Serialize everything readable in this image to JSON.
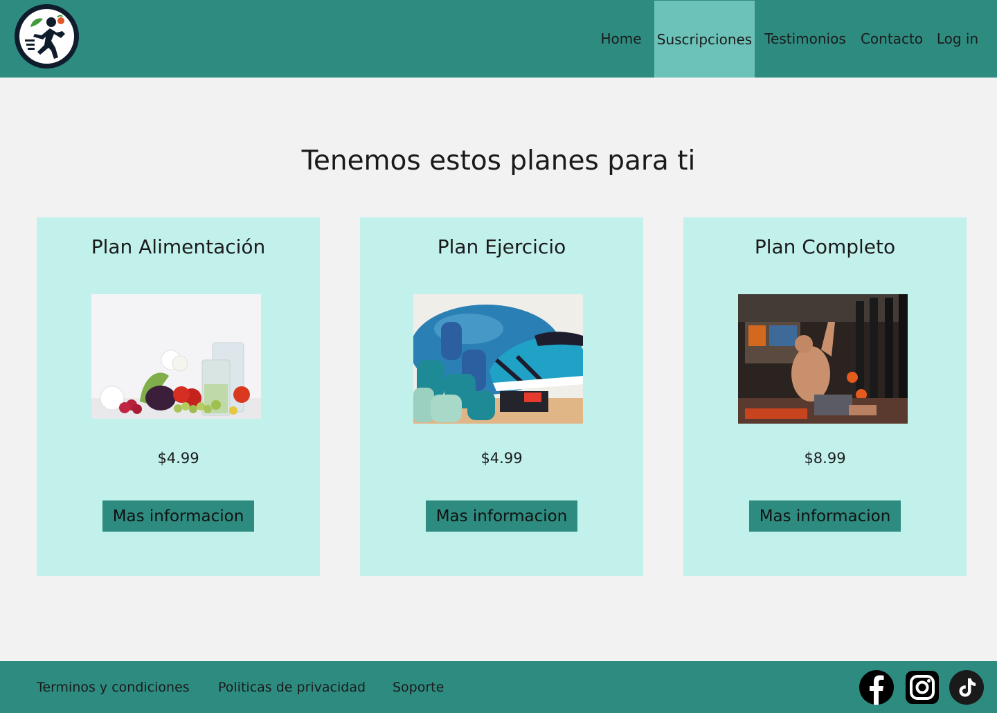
{
  "nav": {
    "home": "Home",
    "suscripciones": "Suscripciones",
    "testimonios": "Testimonios",
    "contacto": "Contacto",
    "login": "Log in",
    "active": "Suscripciones"
  },
  "main": {
    "heading": "Tenemos estos planes para ti"
  },
  "plans": [
    {
      "title": "Plan Alimentación",
      "price": "$4.99",
      "button": "Mas informacion",
      "image": "vegetables-and-water-photo"
    },
    {
      "title": "Plan Ejercicio",
      "price": "$4.99",
      "button": "Mas informacion",
      "image": "dumbbells-and-sneaker-photo"
    },
    {
      "title": "Plan Completo",
      "price": "$8.99",
      "button": "Mas informacion",
      "image": "gym-workout-photo"
    }
  ],
  "footer": {
    "terms": "Terminos y condiciones",
    "privacy": "Politicas de privacidad",
    "support": "Soporte",
    "social": [
      "facebook-icon",
      "instagram-icon",
      "tiktok-icon"
    ]
  },
  "colors": {
    "brand": "#2e8b80",
    "nav_active": "#6cc2b8",
    "card_bg": "#c2f1ec",
    "page_bg": "#f2f2f2"
  }
}
